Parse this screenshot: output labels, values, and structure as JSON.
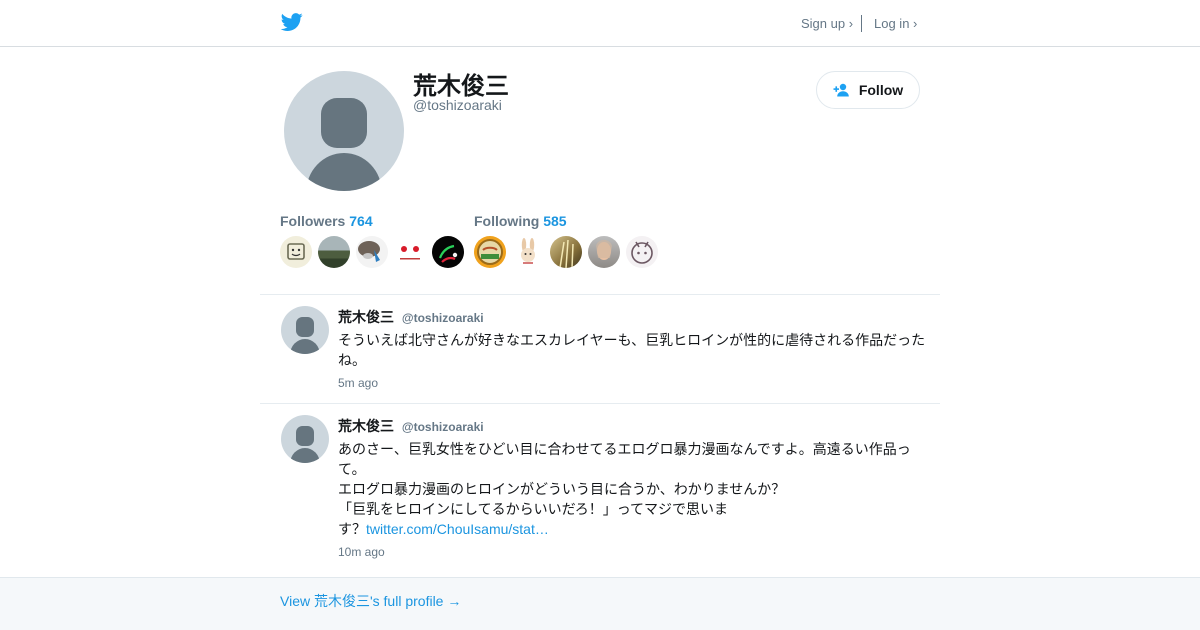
{
  "header": {
    "signup_label": "Sign up ›",
    "login_label": "Log in ›"
  },
  "profile": {
    "name": "荒木俊三",
    "handle": "@toshizoaraki",
    "follow_label": "Follow"
  },
  "stats": {
    "followers_label": "Followers",
    "followers_count": "764",
    "following_label": "Following",
    "following_count": "585"
  },
  "tweets": [
    {
      "name": "荒木俊三",
      "handle": "@toshizoaraki",
      "lines": [
        "そういえば北守さんが好きなエスカレイヤーも、巨乳ヒロインが性的に虐待される作品だった",
        "ね。"
      ],
      "link": "",
      "time": "5m ago"
    },
    {
      "name": "荒木俊三",
      "handle": "@toshizoaraki",
      "lines": [
        "あのさー、巨乳女性をひどい目に合わせてるエログロ暴力漫画なんですよ。高遠るい作品っ",
        "て。",
        "エログロ暴力漫画のヒロインがどういう目に合うか、わかりませんか？",
        "「巨乳をヒロインにしてるからいいだろ！」ってマジで思いま",
        "す？"
      ],
      "link": "twitter.com/ChouIsamu/stat…",
      "time": "10m ago"
    }
  ],
  "footer": {
    "link_label": "View 荒木俊三's full profile →"
  },
  "colors": {
    "accent": "#1b95e0",
    "twitter_blue": "#1da1f2",
    "muted": "#657786",
    "placeholder_bg": "#ccd6dd",
    "placeholder_fg": "#66757f"
  }
}
